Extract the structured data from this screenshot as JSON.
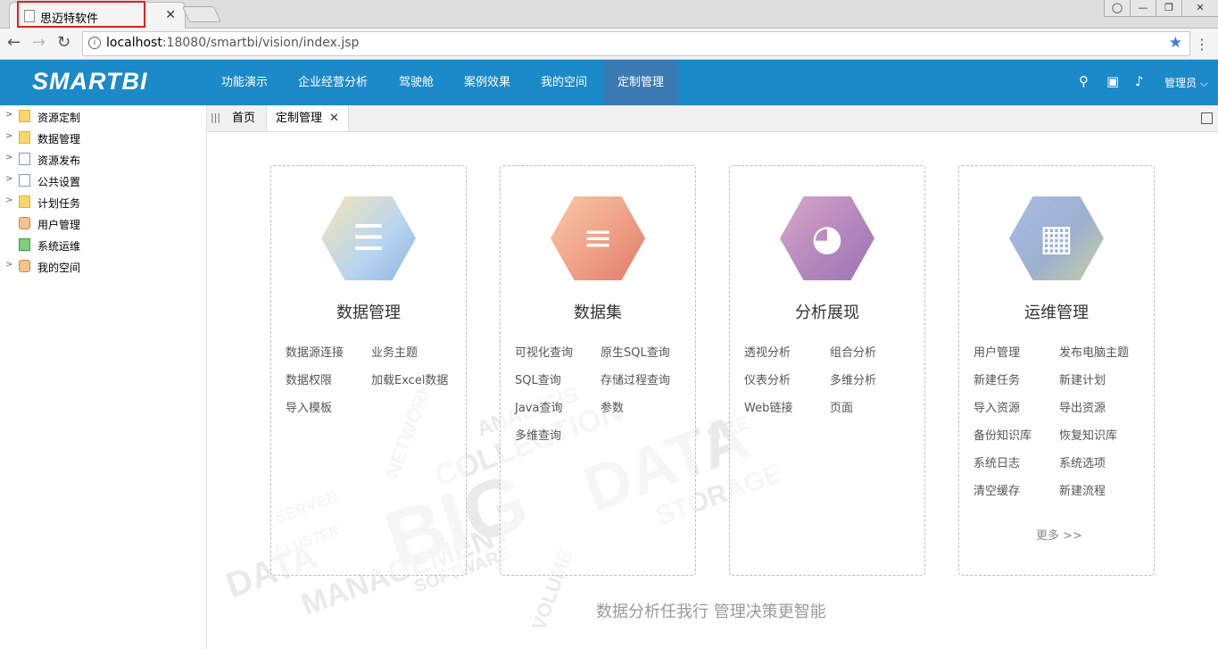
{
  "browser": {
    "tab_title": "思迈特软件",
    "tab_close": "✕",
    "url_host": "localhost",
    "url_rest": ":18080/smartbi/vision/index.jsp"
  },
  "header": {
    "logo": "SMARTBI",
    "nav": [
      "功能演示",
      "企业经营分析",
      "驾驶舱",
      "案例效果",
      "我的空间",
      "定制管理"
    ],
    "active_nav": "定制管理",
    "user": "管理员"
  },
  "sidebar": {
    "items": [
      {
        "label": "资源定制",
        "icon": "folder-icon",
        "expandable": true
      },
      {
        "label": "数据管理",
        "icon": "folder-icon",
        "expandable": true
      },
      {
        "label": "资源发布",
        "icon": "publish-icon",
        "expandable": true
      },
      {
        "label": "公共设置",
        "icon": "settings-icon",
        "expandable": true
      },
      {
        "label": "计划任务",
        "icon": "schedule-icon",
        "expandable": true
      },
      {
        "label": "用户管理",
        "icon": "users-icon",
        "expandable": false
      },
      {
        "label": "系统运维",
        "icon": "maintenance-icon",
        "expandable": false
      },
      {
        "label": "我的空间",
        "icon": "user-icon",
        "expandable": true
      }
    ]
  },
  "tabs": {
    "home": "首页",
    "current": "定制管理",
    "close": "✕"
  },
  "cards": [
    {
      "title": "数据管理",
      "icon": "database-gear-icon",
      "links": [
        "数据源连接",
        "业务主题",
        "数据权限",
        "加载Excel数据",
        "导入模板"
      ]
    },
    {
      "title": "数据集",
      "icon": "dataset-icon",
      "links": [
        "可视化查询",
        "原生SQL查询",
        "SQL查询",
        "存储过程查询",
        "Java查询",
        "参数",
        "多维查询"
      ]
    },
    {
      "title": "分析展现",
      "icon": "pie-chart-icon",
      "links": [
        "透视分析",
        "组合分析",
        "仪表分析",
        "多维分析",
        "Web链接",
        "页面"
      ]
    },
    {
      "title": "运维管理",
      "icon": "monitor-chart-icon",
      "links": [
        "用户管理",
        "发布电脑主题",
        "新建任务",
        "新建计划",
        "导入资源",
        "导出资源",
        "备份知识库",
        "恢复知识库",
        "系统日志",
        "系统选项",
        "清空缓存",
        "新建流程"
      ],
      "more": "更多 >>"
    }
  ],
  "slogan": "数据分析任我行  管理决策更智能",
  "colors": {
    "header_bg": "#1c89c8",
    "active_nav_bg": "#3b7ab3",
    "tab_highlight": "#e02020"
  }
}
